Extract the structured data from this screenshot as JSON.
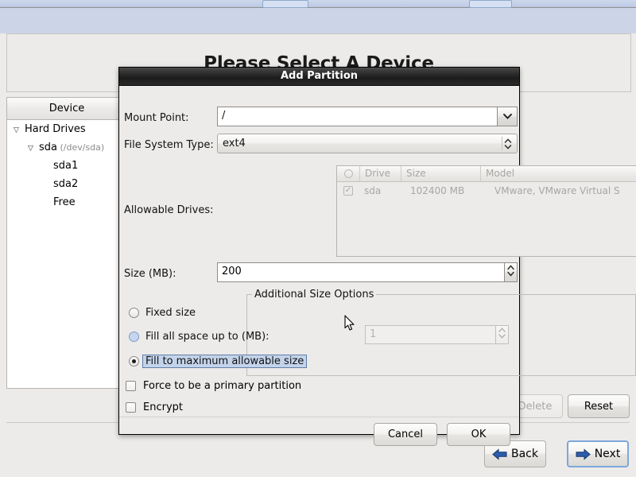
{
  "background": {
    "title": "Please Select A Device",
    "tree": {
      "column_header": "Device",
      "rows": [
        {
          "label": "Hard Drives",
          "sub": "",
          "indent": 0,
          "arrow": "triangle-down"
        },
        {
          "label": "sda",
          "sub": "(/dev/sda)",
          "indent": 1,
          "arrow": "triangle-down"
        },
        {
          "label": "sda1",
          "sub": "",
          "indent": 2,
          "arrow": ""
        },
        {
          "label": "sda2",
          "sub": "",
          "indent": 2,
          "arrow": ""
        },
        {
          "label": "Free",
          "sub": "",
          "indent": 2,
          "arrow": ""
        }
      ]
    },
    "action_buttons": [
      {
        "label": "Delete",
        "enabled": false
      },
      {
        "label": "Reset",
        "enabled": true
      }
    ],
    "nav_buttons": [
      {
        "label": "Back",
        "icon": "arrow-left-icon",
        "focused": false
      },
      {
        "label": "Next",
        "icon": "arrow-right-icon",
        "focused": true
      }
    ]
  },
  "dialog": {
    "title": "Add Partition",
    "mount_point": {
      "label": "Mount Point:",
      "value": "/",
      "placeholder": "",
      "dropdown_icon": "chevron-down-icon"
    },
    "file_system_type": {
      "label": "File System Type:",
      "value": "ext4",
      "spinner_icon": "chevron-up-down-icon"
    },
    "allowable_drives": {
      "label": "Allowable Drives:",
      "columns": [
        "O",
        "Drive",
        "Size",
        "Model"
      ],
      "rows": [
        {
          "checked": true,
          "drive": "sda",
          "size": "102400 MB",
          "model": "VMware, VMware Virtual S"
        }
      ],
      "disabled": true
    },
    "size": {
      "label": "Size (MB):",
      "value": "200",
      "spinner_icon": "spinner-up-down-icon"
    },
    "additional_size_options": {
      "legend": "Additional Size Options",
      "options": [
        {
          "label": "Fixed size",
          "selected": false,
          "hover": false,
          "focused": false
        },
        {
          "label": "Fill all space up to (MB):",
          "selected": false,
          "hover": true,
          "focused": false
        },
        {
          "label": "Fill to maximum allowable size",
          "selected": true,
          "hover": false,
          "focused": true
        }
      ],
      "fill_up_to_value": "1",
      "fill_up_to_disabled": true
    },
    "checkboxes": [
      {
        "label": "Force to be a primary partition",
        "checked": false
      },
      {
        "label": "Encrypt",
        "checked": false
      }
    ],
    "buttons": [
      {
        "label": "Cancel"
      },
      {
        "label": "OK"
      }
    ]
  },
  "colors": {
    "dialog_titlebar": "#1c1c1c",
    "window_background": "#ecebe9",
    "banner": "#ccd4e8",
    "focus_blue": "#7da7d9",
    "selection_blue": "#c3d3ea",
    "arrow_blue": "#2b5eac"
  }
}
